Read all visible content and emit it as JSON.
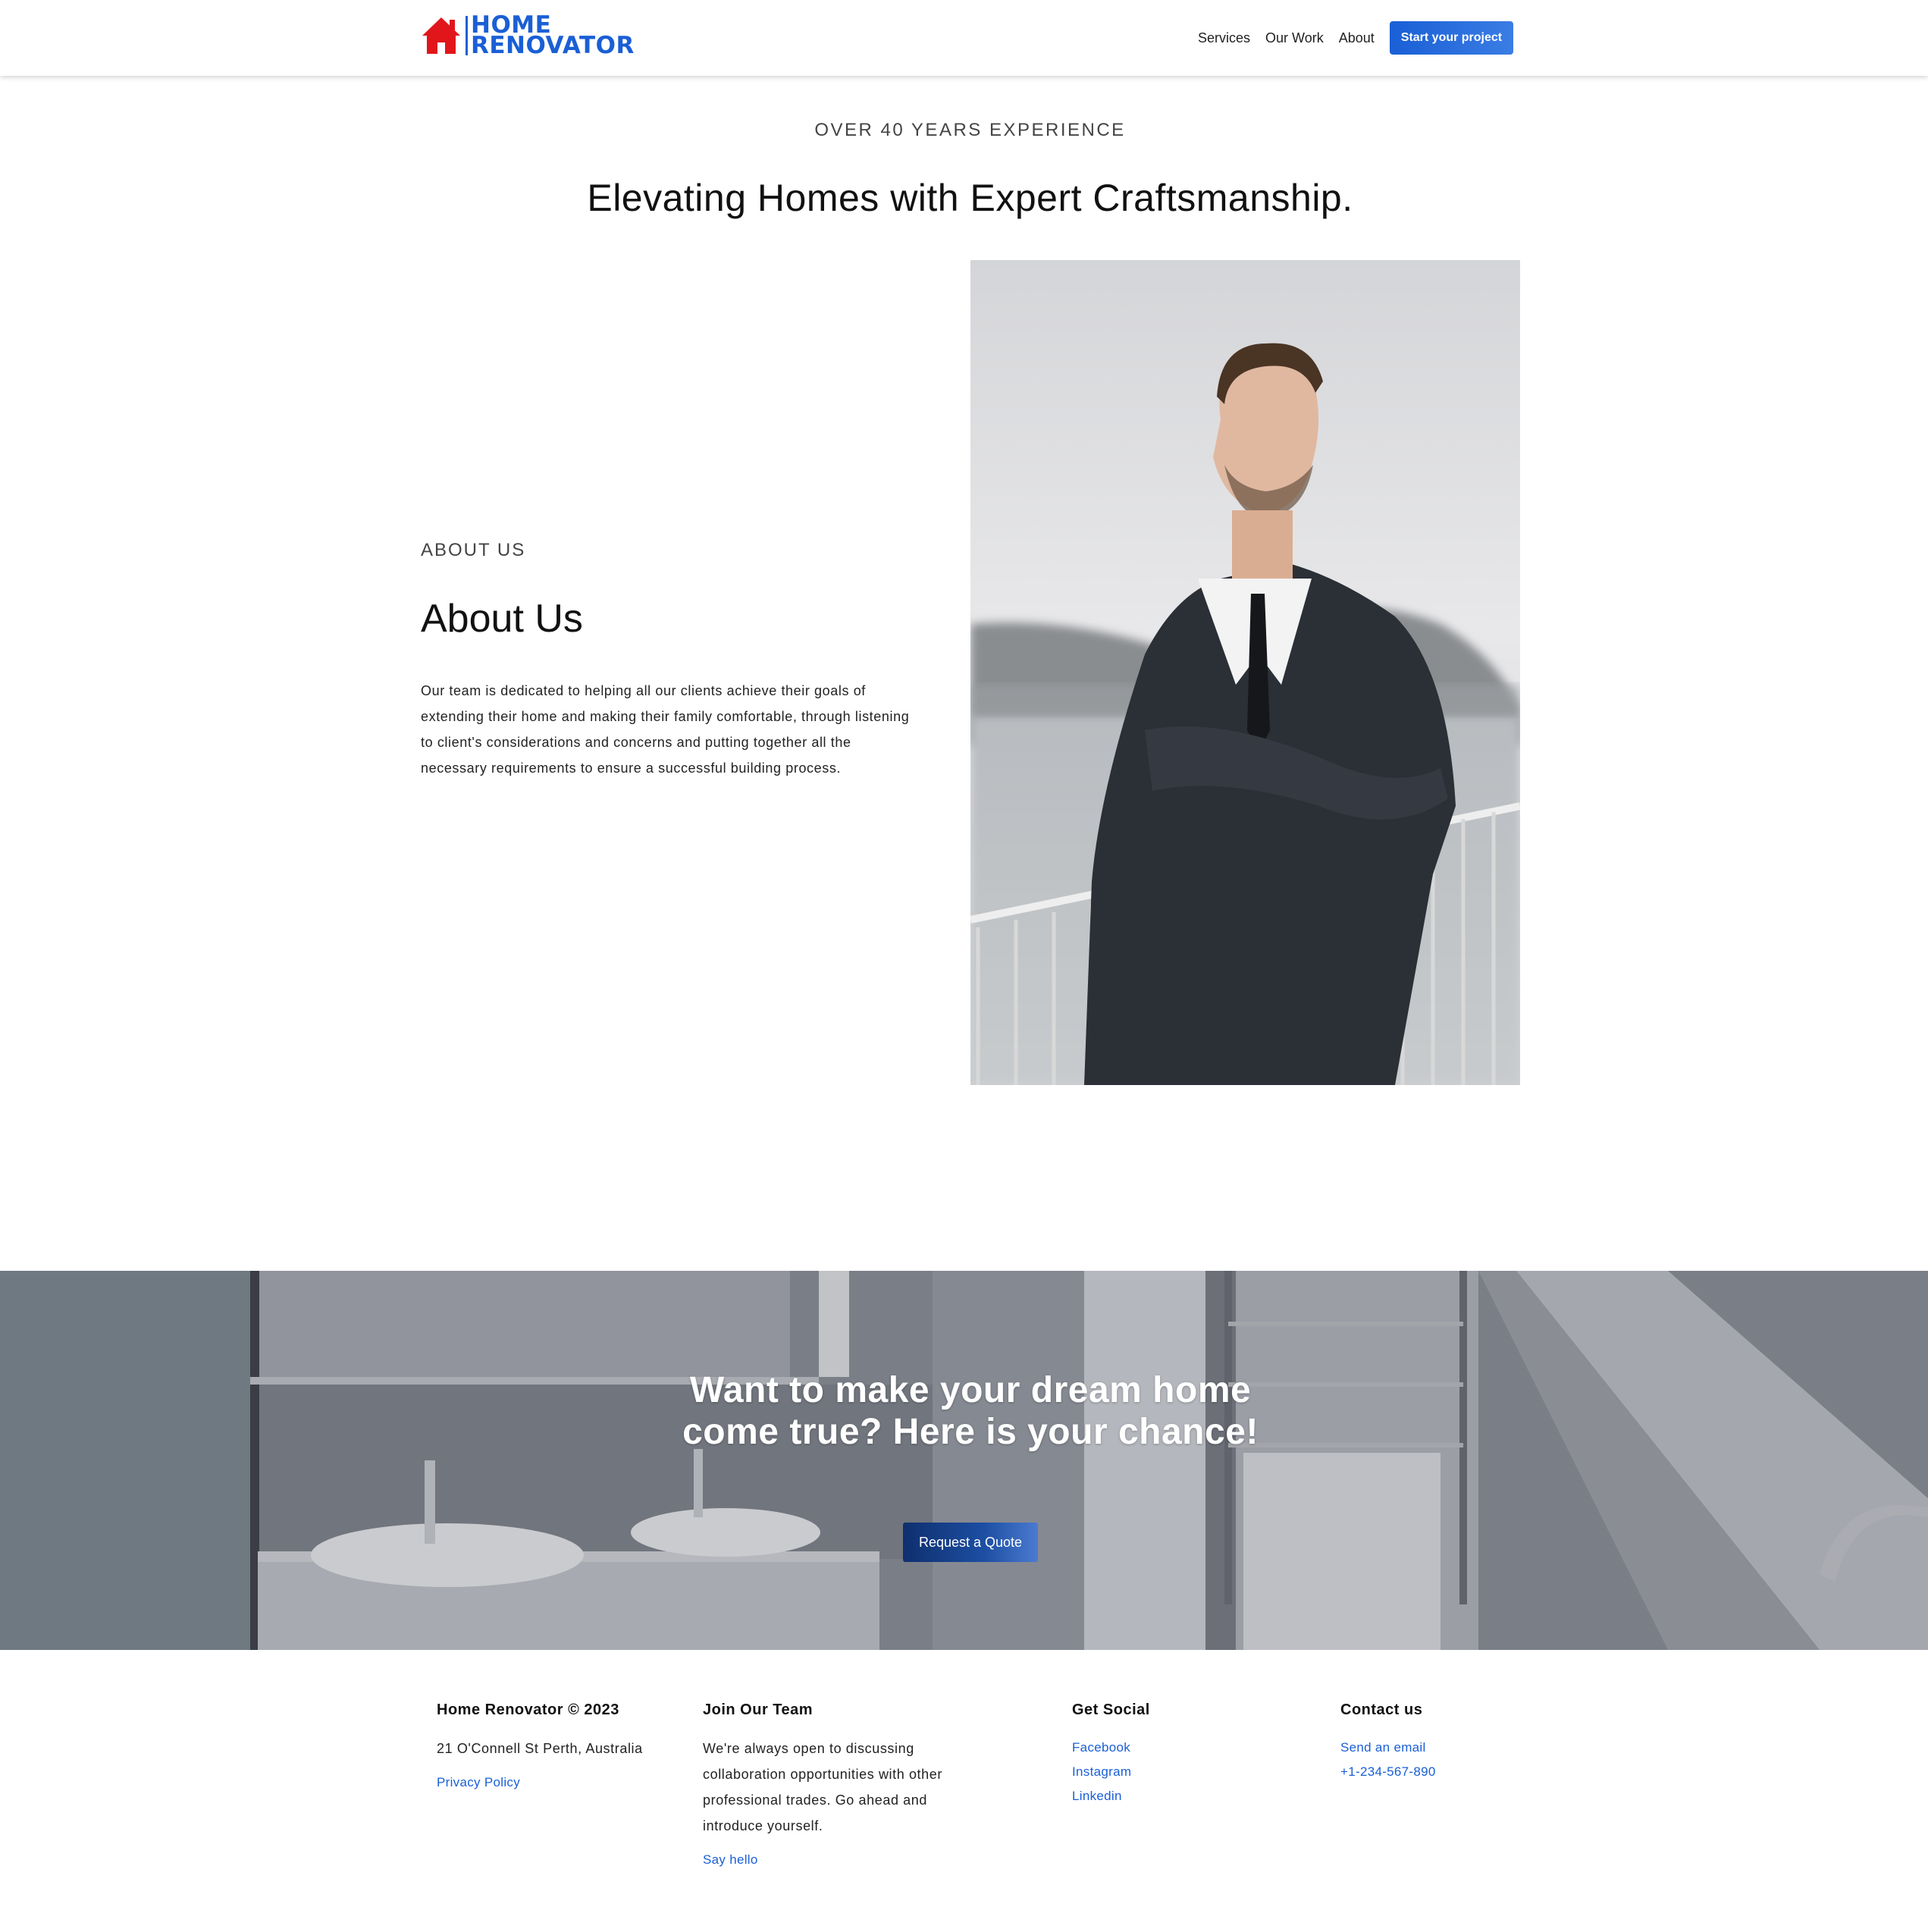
{
  "brand": {
    "line1": "HOME",
    "line2": "RENOVATOR",
    "color": "#1a5fd6",
    "house_color": "#e0161b"
  },
  "nav": {
    "items": [
      "Services",
      "Our Work",
      "About"
    ],
    "cta": "Start your project"
  },
  "hero": {
    "eyebrow": "OVER 40 YEARS EXPERIENCE",
    "title": "Elevating Homes with Expert Craftsmanship."
  },
  "about": {
    "eyebrow": "ABOUT US",
    "title": "About Us",
    "body": "Our team is dedicated to helping all our clients achieve their goals of extending their home and making their family comfortable, through listening to client's considerations and concerns and putting together all the necessary requirements to ensure a successful building process."
  },
  "banner": {
    "title": "Want to make your dream home come true? Here is your chance!",
    "button": "Request a Quote"
  },
  "footer": {
    "company": {
      "title": "Home Renovator © 2023",
      "address": "21 O'Connell St Perth, Australia",
      "privacy": "Privacy Policy"
    },
    "join": {
      "title": "Join Our Team",
      "text": "We're always open to discussing collaboration opportunities with other professional trades. Go ahead and introduce yourself.",
      "link": "Say hello"
    },
    "social": {
      "title": "Get Social",
      "links": [
        "Facebook",
        "Instagram",
        "Linkedin"
      ]
    },
    "contact": {
      "title": "Contact us",
      "email": "Send an email",
      "phone": "+1-234-567-890"
    }
  }
}
